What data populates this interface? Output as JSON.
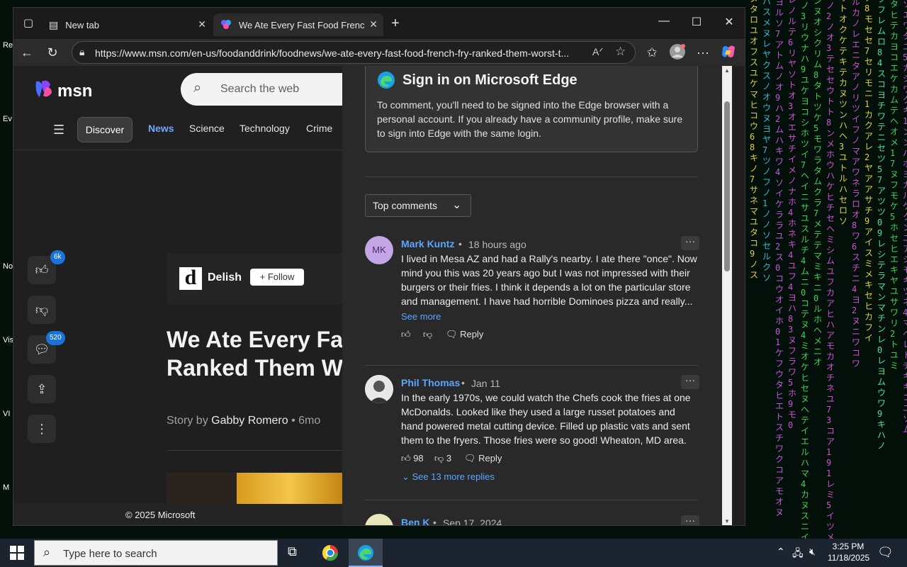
{
  "desktop": {
    "icon_labels": [
      "Re",
      "Ev",
      "No",
      "Vis",
      "VI",
      "M"
    ]
  },
  "browser": {
    "tabs": [
      {
        "title": "New tab",
        "icon": "new-tab-icon",
        "active": false
      },
      {
        "title": "We Ate Every Fast Food French Fr",
        "icon": "msn-icon",
        "active": true
      }
    ],
    "address": "https://www.msn.com/en-us/foodanddrink/foodnews/we-ate-every-fast-food-french-fry-ranked-them-worst-t..."
  },
  "msn": {
    "logo_text": "msn",
    "search_placeholder": "Search the web",
    "nav": [
      "Discover",
      "News",
      "Science",
      "Technology",
      "Crime"
    ],
    "side_badges": {
      "likes": "6k",
      "comments": "520"
    },
    "publisher": "Delish",
    "publisher_logo_letter": "d",
    "follow_label": "Follow",
    "headline_line1": "We Ate Every Fast",
    "headline_line2": "Ranked Them Wo",
    "byline_prefix": "Story by",
    "author": "Gabby Romero",
    "age": "6mo",
    "footer": "© 2025 Microsoft"
  },
  "comments_panel": {
    "signin_title": "Sign in on Microsoft Edge",
    "signin_body": "To comment, you'll need to be signed into the Edge browser with a personal account. If you already have a community profile, make sure to sign into Edge with the same login.",
    "sort_label": "Top comments",
    "comments": [
      {
        "initials": "MK",
        "name": "Mark Kuntz",
        "time": "18 hours ago",
        "body": "I lived in Mesa  AZ and had a Rally's nearby. I ate there \"once\". Now mind you this was 20 years ago but I was not impressed with their burgers or their fries. I think it depends a lot on the particular store and management. I have had horrible Dominoes pizza and really...",
        "see_more": "See more",
        "reply": "Reply"
      },
      {
        "name": "Phil Thomas",
        "time": "Jan 11",
        "body": "In the early 1970s, we could watch the Chefs cook the fries at one McDonalds.  Looked like they used a large russet potatoes and hand powered metal cutting device. Filled up plastic vats and sent them to the fryers. Those fries were so good! Wheaton, MD area.",
        "likes": "98",
        "dislikes": "3",
        "reply": "Reply",
        "replies_link": "See 13 more replies"
      },
      {
        "name": "Ben K",
        "time": "Sep 17, 2024"
      }
    ]
  },
  "taskbar": {
    "search_placeholder": "Type here to search",
    "time": "3:25 PM",
    "date": "11/18/2025"
  }
}
